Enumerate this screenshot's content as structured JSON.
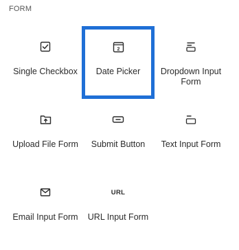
{
  "section": {
    "title": "FORM"
  },
  "tiles": [
    {
      "icon": "checkbox-icon",
      "label": "Single Checkbox"
    },
    {
      "icon": "calendar-icon",
      "label": "Date Picker",
      "icon_text": "2",
      "selected": true
    },
    {
      "icon": "dropdown-icon",
      "label": "Dropdown Input Form"
    },
    {
      "icon": "folder-upload-icon",
      "label": "Upload File Form"
    },
    {
      "icon": "button-icon",
      "label": "Submit Button"
    },
    {
      "icon": "text-input-icon",
      "label": "Text Input Form"
    },
    {
      "icon": "envelope-icon",
      "label": "Email Input Form"
    },
    {
      "icon": "url-icon",
      "label": "URL Input Form",
      "icon_text": "URL"
    }
  ],
  "colors": {
    "selection_border": "#1f6fd6",
    "text": "#2b2b2b"
  }
}
